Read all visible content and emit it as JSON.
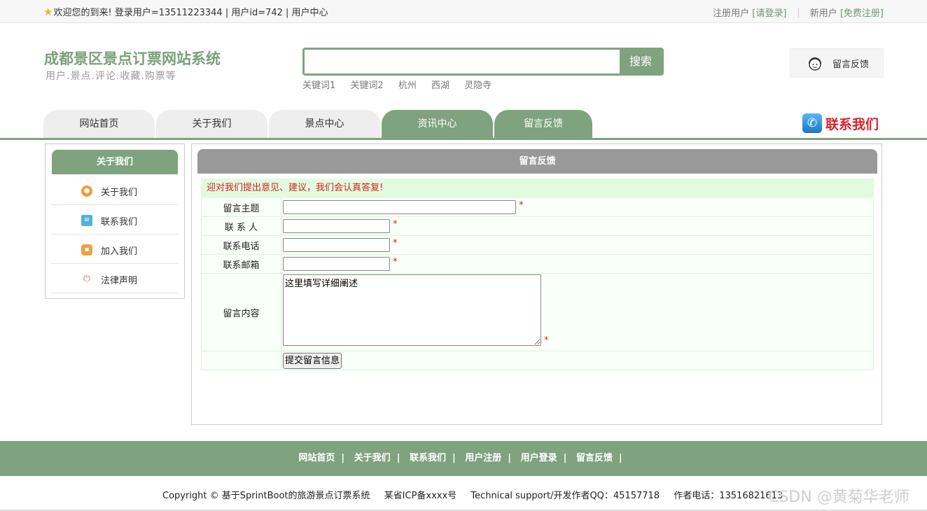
{
  "topbar": {
    "welcome": "欢迎您的到来!",
    "user_info": "登录用户=13511223344 | 用户id=742 | 用户中心",
    "register_user": "注册用户",
    "login_link": "[请登录]",
    "new_user": "新用户",
    "free_register": "[免费注册]"
  },
  "header": {
    "title": "成都景区景点订票网站系统",
    "subtitle": "用户.景点.评论.收藏.购票等",
    "search_placeholder": "",
    "search_button": "搜索",
    "keywords": [
      "关键词1",
      "关键词2",
      "杭州",
      "西湖",
      "灵隐寺"
    ],
    "feedback_label": "留言反馈"
  },
  "nav": {
    "items": [
      "网站首页",
      "关于我们",
      "景点中心",
      "资讯中心",
      "留言反馈"
    ],
    "active_index": 3,
    "contact_us": "联系我们"
  },
  "sidebar": {
    "title": "关于我们",
    "items": [
      {
        "label": "关于我们",
        "icon": "circle-orange-icon",
        "color": "#f49b35"
      },
      {
        "label": "联系我们",
        "icon": "clipboard-icon",
        "color": "#4fb3d9"
      },
      {
        "label": "加入我们",
        "icon": "lock-icon",
        "color": "#f0a045"
      },
      {
        "label": "法律声明",
        "icon": "power-icon",
        "color": "#c97a7a"
      }
    ]
  },
  "content": {
    "title": "留言反馈",
    "notice": "迎对我们提出意见、建议，我们会认真答复!",
    "fields": {
      "subject": "留言主题",
      "contact": "联 系 人",
      "phone": "联系电话",
      "email": "联系邮箱",
      "message": "留言内容"
    },
    "required_mark": "*",
    "message_default": "这里填写详细阐述",
    "submit": "提交留言信息"
  },
  "footer": {
    "links": [
      "网站首页",
      "关于我们",
      "联系我们",
      "用户注册",
      "用户登录",
      "留言反馈"
    ],
    "separator": "|",
    "copyright": "Copyright © 基于SprintBoot的旅游景点订票系统",
    "icp": "某省ICP备xxxx号",
    "support": "Technical support/开发作者QQ：45157718",
    "phone": "作者电话：13516821613",
    "watermark": "CSDN @黄菊华老师"
  },
  "colors": {
    "brand_green": "#7ea37e",
    "header_gray": "#999999",
    "notice_bg": "#e2fbe0",
    "required_red": "#e02020",
    "contact_red": "#d8222a"
  }
}
